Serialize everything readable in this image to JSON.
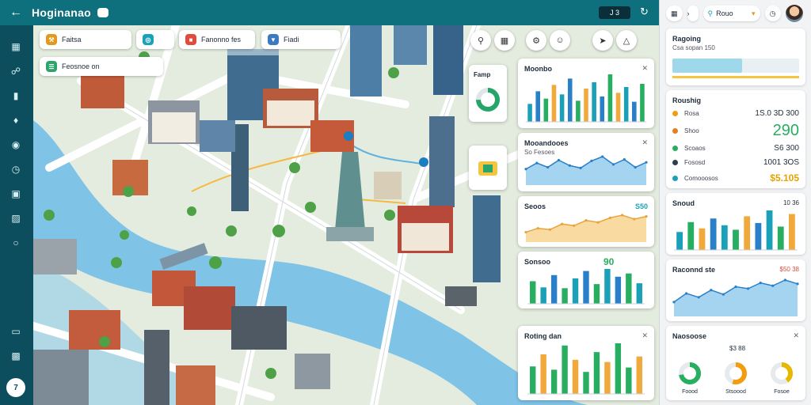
{
  "app": {
    "title": "Hoginanao",
    "counter": "J 3"
  },
  "rail": {
    "help_label": "7"
  },
  "map_chips": [
    {
      "label": "Faitsa",
      "icon": "wrench-icon",
      "color": "#e09a1e"
    },
    {
      "label": "",
      "icon": "bike-icon",
      "color": "#1aa1b8"
    },
    {
      "label": "Fanonno fes",
      "icon": "bus-icon",
      "color": "#e04b3b"
    },
    {
      "label": "Fiadi",
      "icon": "filter-icon",
      "color": "#3c7bc0"
    },
    {
      "label": "Feosnoe on",
      "icon": "layers-icon",
      "color": "#2aa56b"
    }
  ],
  "map_buttons": [
    "zoom-icon",
    "grid-icon",
    "tools-icon",
    "user-icon",
    "ride-icon",
    "cart-icon"
  ],
  "map_cards": {
    "mini_gauge": {
      "title": "Famp"
    },
    "mini_legend": {
      "title": ""
    },
    "c1": {
      "title": "Moonbo",
      "values": [
        34,
        58,
        44,
        70,
        52,
        82,
        40,
        63,
        75,
        48,
        90,
        55,
        66,
        38,
        72
      ]
    },
    "c2": {
      "title": "Mooandooes",
      "subtitle": "So  Fesoes",
      "values": [
        45,
        62,
        50,
        70,
        55,
        48,
        68,
        80,
        58,
        72,
        50,
        64
      ]
    },
    "c3": {
      "title": "Seoos",
      "readout": "S50",
      "values": [
        30,
        42,
        38,
        55,
        50,
        66,
        60,
        74,
        82,
        70,
        78
      ]
    },
    "c4": {
      "title": "Sonsoo",
      "readout": "90",
      "values": [
        55,
        40,
        70,
        38,
        62,
        80,
        48,
        85,
        66,
        74,
        50
      ]
    },
    "c5": {
      "title": "Roting dan",
      "values": [
        50,
        72,
        44,
        88,
        62,
        40,
        76,
        58,
        92,
        48,
        68
      ]
    }
  },
  "panel": {
    "search_label": "Rouo",
    "summary": {
      "title": "Ragoing",
      "subtitle": "Csa sopan 150",
      "progress": 0.55
    },
    "routing": {
      "title": "Roushig",
      "rows": [
        {
          "label": "Rosa",
          "value": "1S.0 3D  300",
          "color": "#f39c12"
        },
        {
          "label": "Shoo",
          "value": "290",
          "color": "#e67e22"
        },
        {
          "label": "Scoaos",
          "value": "S6 300",
          "color": "#27ae60"
        },
        {
          "label": "Fososd",
          "value": "1001 3OS",
          "color": "#2c3e50"
        },
        {
          "label": "Comooosos",
          "value": "$5.105",
          "color": "#1aa1b8"
        }
      ]
    },
    "trend": {
      "title": "Snoud",
      "readout": "10 36",
      "values": [
        40,
        62,
        48,
        70,
        55,
        45,
        75,
        60,
        88,
        52,
        80
      ]
    },
    "traffic": {
      "title": "Raconnd ste",
      "readout": "$50 38",
      "values": [
        30,
        48,
        40,
        55,
        46,
        62,
        58,
        70,
        64,
        76,
        68
      ]
    },
    "insight": {
      "title": "Naosoose",
      "readout": "$3 88",
      "donuts": [
        {
          "label": "Foood",
          "fraction": 0.72,
          "color": "#27ae60"
        },
        {
          "label": "Stsoood",
          "fraction": 0.55,
          "color": "#f39c12"
        },
        {
          "label": "Fosoe",
          "fraction": 0.4,
          "color": "#e6b800"
        }
      ]
    }
  }
}
